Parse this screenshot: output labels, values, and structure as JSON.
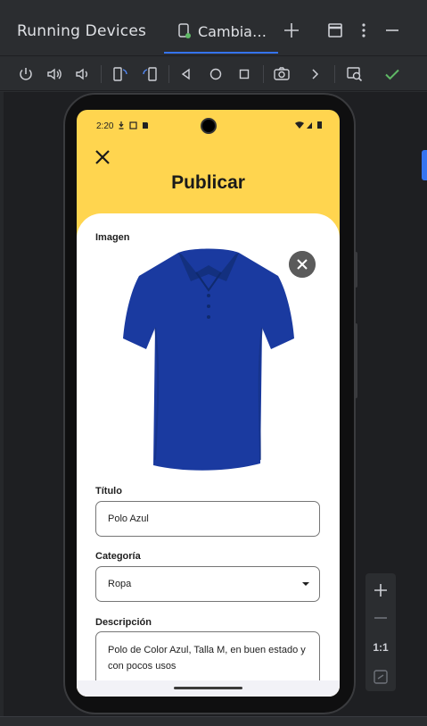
{
  "window": {
    "title": "Running Devices",
    "tab_label": "Cambia…"
  },
  "toolbar": {
    "tools": [
      "power-icon",
      "volume-up-icon",
      "volume-down-icon",
      "rotate-left-icon",
      "rotate-right-icon",
      "back-icon",
      "home-icon",
      "overview-icon",
      "screenshot-icon",
      "more-chevron-icon",
      "mirror-zoom-icon",
      "check-icon"
    ]
  },
  "zoom": {
    "ratio_label": "1:1"
  },
  "phone": {
    "status_time": "2:20",
    "app_title": "Publicar",
    "image_label": "Imagen",
    "title_label": "Título",
    "title_value": "Polo Azul",
    "category_label": "Categoría",
    "category_value": "Ropa",
    "description_label": "Descripción",
    "description_value": "Polo de Color Azul, Talla M, en buen estado y con pocos usos"
  },
  "colors": {
    "accent": "#3574f0",
    "app_header": "#ffd54f",
    "shirt": "#1a3aa0",
    "check": "#5fb865"
  }
}
